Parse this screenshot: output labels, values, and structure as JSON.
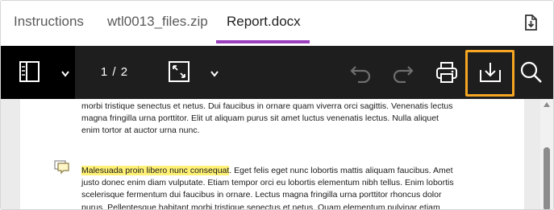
{
  "tabs": [
    {
      "label": "Instructions"
    },
    {
      "label": "wtl0013_files.zip"
    },
    {
      "label": "Report.docx"
    }
  ],
  "active_tab_index": 2,
  "colors": {
    "accent_underline": "#9b3fbf",
    "focus_outline": "#f5a623",
    "highlight": "#fff176",
    "toolbar_bg": "#1e1e1e"
  },
  "icons": {
    "tab_download": "download-icon",
    "sidebar_toggle": "sidebar-panel-icon",
    "sidebar_dropdown": "chevron-down-icon",
    "fit": "expand-icon",
    "fit_dropdown": "chevron-down-icon",
    "undo": "undo-icon",
    "redo": "redo-icon",
    "print": "printer-icon",
    "download": "download-icon",
    "search": "search-icon",
    "comment": "comment-icon"
  },
  "toolbar": {
    "page_indicator": "1 / 2"
  },
  "document": {
    "paragraph1_lines": [
      "morbi tristique senectus et netus. Dui faucibus in ornare quam viverra orci sagittis. Venenatis lectus",
      "magna fringilla urna porttitor. Elit ut aliquam purus sit amet luctus venenatis lectus. Nulla aliquet",
      "enim tortor at auctor urna nunc."
    ],
    "paragraph2_highlight": "Malesuada proin libero nunc consequat",
    "paragraph2_first_rest": ". Eget felis eget nunc lobortis mattis aliquam faucibus. Amet",
    "paragraph2_lines": [
      "justo donec enim diam vulputate. Etiam tempor orci eu lobortis elementum nibh tellus. Enim lobortis",
      "scelerisque fermentum dui faucibus in ornare. Lectus magna fringilla urna porttitor rhoncus dolor",
      "purus. Pellentesque habitant morbi tristique senectus et netus. Quam elementum pulvinar etiam"
    ]
  }
}
